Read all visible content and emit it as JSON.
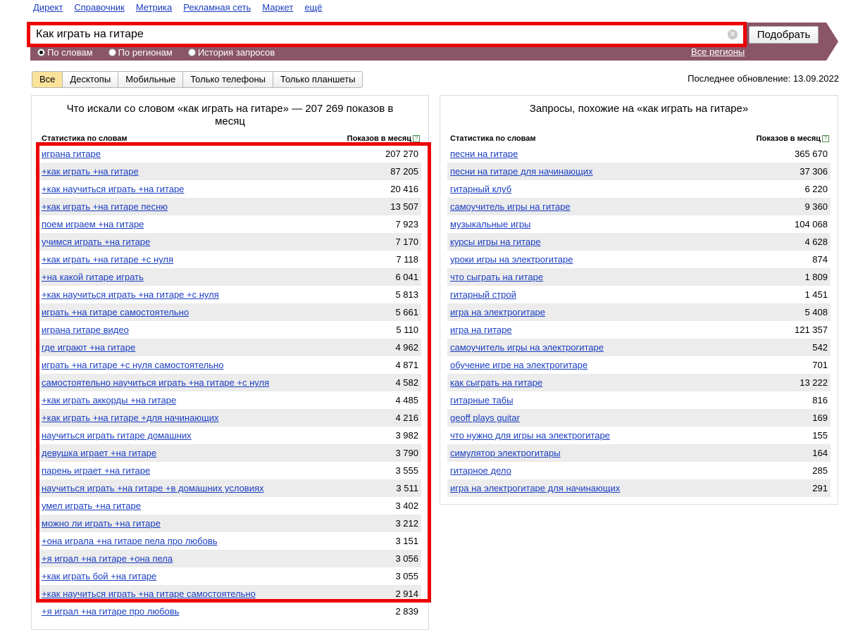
{
  "topnav": [
    "Директ",
    "Справочник",
    "Метрика",
    "Рекламная сеть",
    "Маркет",
    "ещё"
  ],
  "search": {
    "value": "Как играть на гитаре",
    "button": "Подобрать"
  },
  "modes": {
    "words": "По словам",
    "regions": "По регионам",
    "history": "История запросов",
    "all_regions": "Все регионы"
  },
  "tabs": [
    "Все",
    "Десктопы",
    "Мобильные",
    "Только телефоны",
    "Только планшеты"
  ],
  "updated": "Последнее обновление: 13.09.2022",
  "left": {
    "title": "Что искали со словом «как играть на гитаре» — 207 269 показов в месяц",
    "col_words": "Статистика по словам",
    "col_shows": "Показов в месяц",
    "rows": [
      {
        "k": "играна гитаре",
        "v": "207 270"
      },
      {
        "k": "+как играть +на гитаре",
        "v": "87 205"
      },
      {
        "k": "+как научиться играть +на гитаре",
        "v": "20 416"
      },
      {
        "k": "+как играть +на гитаре песню",
        "v": "13 507"
      },
      {
        "k": "поем играем +на гитаре",
        "v": "7 923"
      },
      {
        "k": "учимся играть +на гитаре",
        "v": "7 170"
      },
      {
        "k": "+как играть +на гитаре +с нуля",
        "v": "7 118"
      },
      {
        "k": "+на какой гитаре играть",
        "v": "6 041"
      },
      {
        "k": "+как научиться играть +на гитаре +с нуля",
        "v": "5 813"
      },
      {
        "k": "играть +на гитаре самостоятельно",
        "v": "5 661"
      },
      {
        "k": "играна гитаре видео",
        "v": "5 110"
      },
      {
        "k": "где играют +на гитаре",
        "v": "4 962"
      },
      {
        "k": "играть +на гитаре +с нуля самостоятельно",
        "v": "4 871"
      },
      {
        "k": "самостоятельно научиться играть +на гитаре +с нуля",
        "v": "4 582"
      },
      {
        "k": "+как играть аккорды +на гитаре",
        "v": "4 485"
      },
      {
        "k": "+как играть +на гитаре +для начинающих",
        "v": "4 216"
      },
      {
        "k": "научиться играть гитаре домашних",
        "v": "3 982"
      },
      {
        "k": "девушка играет +на гитаре",
        "v": "3 790"
      },
      {
        "k": "парень играет +на гитаре",
        "v": "3 555"
      },
      {
        "k": "научиться играть +на гитаре +в домашних условиях",
        "v": "3 511"
      },
      {
        "k": "умел играть +на гитаре",
        "v": "3 402"
      },
      {
        "k": "можно ли играть +на гитаре",
        "v": "3 212"
      },
      {
        "k": "+она играла +на гитаре пела про любовь",
        "v": "3 151"
      },
      {
        "k": "+я играл +на гитаре +она пела",
        "v": "3 056"
      },
      {
        "k": "+как играть бой +на гитаре",
        "v": "3 055"
      },
      {
        "k": "+как научиться играть +на гитаре самостоятельно",
        "v": "2 914"
      },
      {
        "k": "+я играл +на гитаре про любовь",
        "v": "2 839"
      }
    ]
  },
  "right": {
    "title": "Запросы, похожие на «как играть на гитаре»",
    "col_words": "Статистика по словам",
    "col_shows": "Показов в месяц",
    "rows": [
      {
        "k": "песни на гитаре",
        "v": "365 670"
      },
      {
        "k": "песни на гитаре для начинающих",
        "v": "37 306"
      },
      {
        "k": "гитарный клуб",
        "v": "6 220"
      },
      {
        "k": "самоучитель игры на гитаре",
        "v": "9 360"
      },
      {
        "k": "музыкальные игры",
        "v": "104 068"
      },
      {
        "k": "курсы игры на гитаре",
        "v": "4 628"
      },
      {
        "k": "уроки игры на электрогитаре",
        "v": "874"
      },
      {
        "k": "что сыграть на гитаре",
        "v": "1 809"
      },
      {
        "k": "гитарный строй",
        "v": "1 451"
      },
      {
        "k": "игра на электрогитаре",
        "v": "5 408"
      },
      {
        "k": "игра на гитаре",
        "v": "121 357"
      },
      {
        "k": "самоучитель игры на электрогитаре",
        "v": "542"
      },
      {
        "k": "обучение игре на электрогитаре",
        "v": "701"
      },
      {
        "k": "как сыграть на гитаре",
        "v": "13 222"
      },
      {
        "k": "гитарные табы",
        "v": "816"
      },
      {
        "k": "geoff plays guitar",
        "v": "169"
      },
      {
        "k": "что нужно для игры на электрогитаре",
        "v": "155"
      },
      {
        "k": "симулятор электрогитары",
        "v": "164"
      },
      {
        "k": "гитарное дело",
        "v": "285"
      },
      {
        "k": "игра на электрогитаре для начинающих",
        "v": "291"
      }
    ]
  }
}
